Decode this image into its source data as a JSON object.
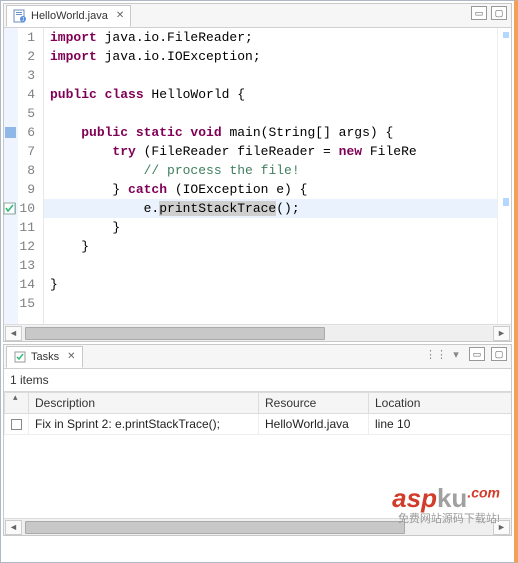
{
  "editor": {
    "tab_label": "HelloWorld.java",
    "lines": [
      {
        "n": 1,
        "tokens": [
          [
            "kw",
            "import"
          ],
          [
            "p",
            " java.io.FileReader;"
          ]
        ]
      },
      {
        "n": 2,
        "tokens": [
          [
            "kw",
            "import"
          ],
          [
            "p",
            " java.io.IOException;"
          ]
        ]
      },
      {
        "n": 3,
        "tokens": []
      },
      {
        "n": 4,
        "tokens": [
          [
            "kw",
            "public class"
          ],
          [
            "p",
            " HelloWorld {"
          ]
        ]
      },
      {
        "n": 5,
        "tokens": []
      },
      {
        "n": 6,
        "tokens": [
          [
            "p",
            "    "
          ],
          [
            "kw",
            "public static void"
          ],
          [
            "p",
            " main(String[] args) {"
          ]
        ],
        "mark": "blue"
      },
      {
        "n": 7,
        "tokens": [
          [
            "p",
            "        "
          ],
          [
            "kw",
            "try"
          ],
          [
            "p",
            " (FileReader fileReader = "
          ],
          [
            "kw",
            "new"
          ],
          [
            "p",
            " FileRe"
          ]
        ]
      },
      {
        "n": 8,
        "tokens": [
          [
            "p",
            "            "
          ],
          [
            "cm",
            "// process the file!"
          ]
        ]
      },
      {
        "n": 9,
        "tokens": [
          [
            "p",
            "        } "
          ],
          [
            "kw",
            "catch"
          ],
          [
            "p",
            " (IOException e) {"
          ]
        ]
      },
      {
        "n": 10,
        "tokens": [
          [
            "p",
            "            e."
          ],
          [
            "sel",
            "printStackTrace"
          ],
          [
            "p",
            "();"
          ]
        ],
        "hl": true,
        "mark": "blue",
        "gutter_icon": "task"
      },
      {
        "n": 11,
        "tokens": [
          [
            "p",
            "        }"
          ]
        ]
      },
      {
        "n": 12,
        "tokens": [
          [
            "p",
            "    }"
          ]
        ]
      },
      {
        "n": 13,
        "tokens": []
      },
      {
        "n": 14,
        "tokens": [
          [
            "p",
            "}"
          ]
        ]
      },
      {
        "n": 15,
        "tokens": []
      }
    ]
  },
  "tasks": {
    "tab_label": "Tasks",
    "count_text": "1 items",
    "columns": [
      "",
      "Description",
      "Resource",
      "Location"
    ],
    "rows": [
      {
        "done": false,
        "description": "Fix in Sprint 2: e.printStackTrace();",
        "resource": "HelloWorld.java",
        "location": "line 10"
      }
    ]
  },
  "watermark": {
    "brand_a": "asp",
    "brand_b": "ku",
    "dot": ".com",
    "sub": "免费网站源码下载站!"
  }
}
